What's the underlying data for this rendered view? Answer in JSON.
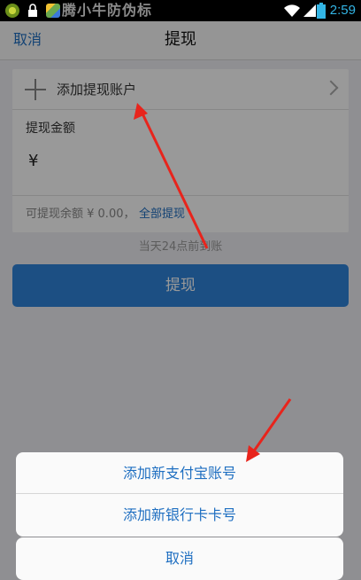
{
  "status_bar": {
    "title": "腾小牛防伪标",
    "time": "2:59",
    "icons": [
      "app-icon",
      "lock-icon",
      "store-icon",
      "wifi-icon",
      "signal-icon",
      "battery-icon"
    ]
  },
  "nav": {
    "cancel_label": "取消",
    "title": "提现"
  },
  "form": {
    "add_account_label": "添加提现账户",
    "amount_label": "提现金额",
    "currency_symbol": "¥",
    "balance_text": "可提现余额 ¥ 0.00，",
    "withdraw_all_label": "全部提现"
  },
  "arrival_note": "当天24点前到账",
  "submit_label": "提现",
  "action_sheet": {
    "items": [
      {
        "label": "添加新支付宝账号"
      },
      {
        "label": "添加新银行卡卡号"
      }
    ],
    "cancel_label": "取消"
  },
  "colors": {
    "accent": "#1f6fc1",
    "button": "#2f84db",
    "annotation_arrow": "#e8241c"
  }
}
